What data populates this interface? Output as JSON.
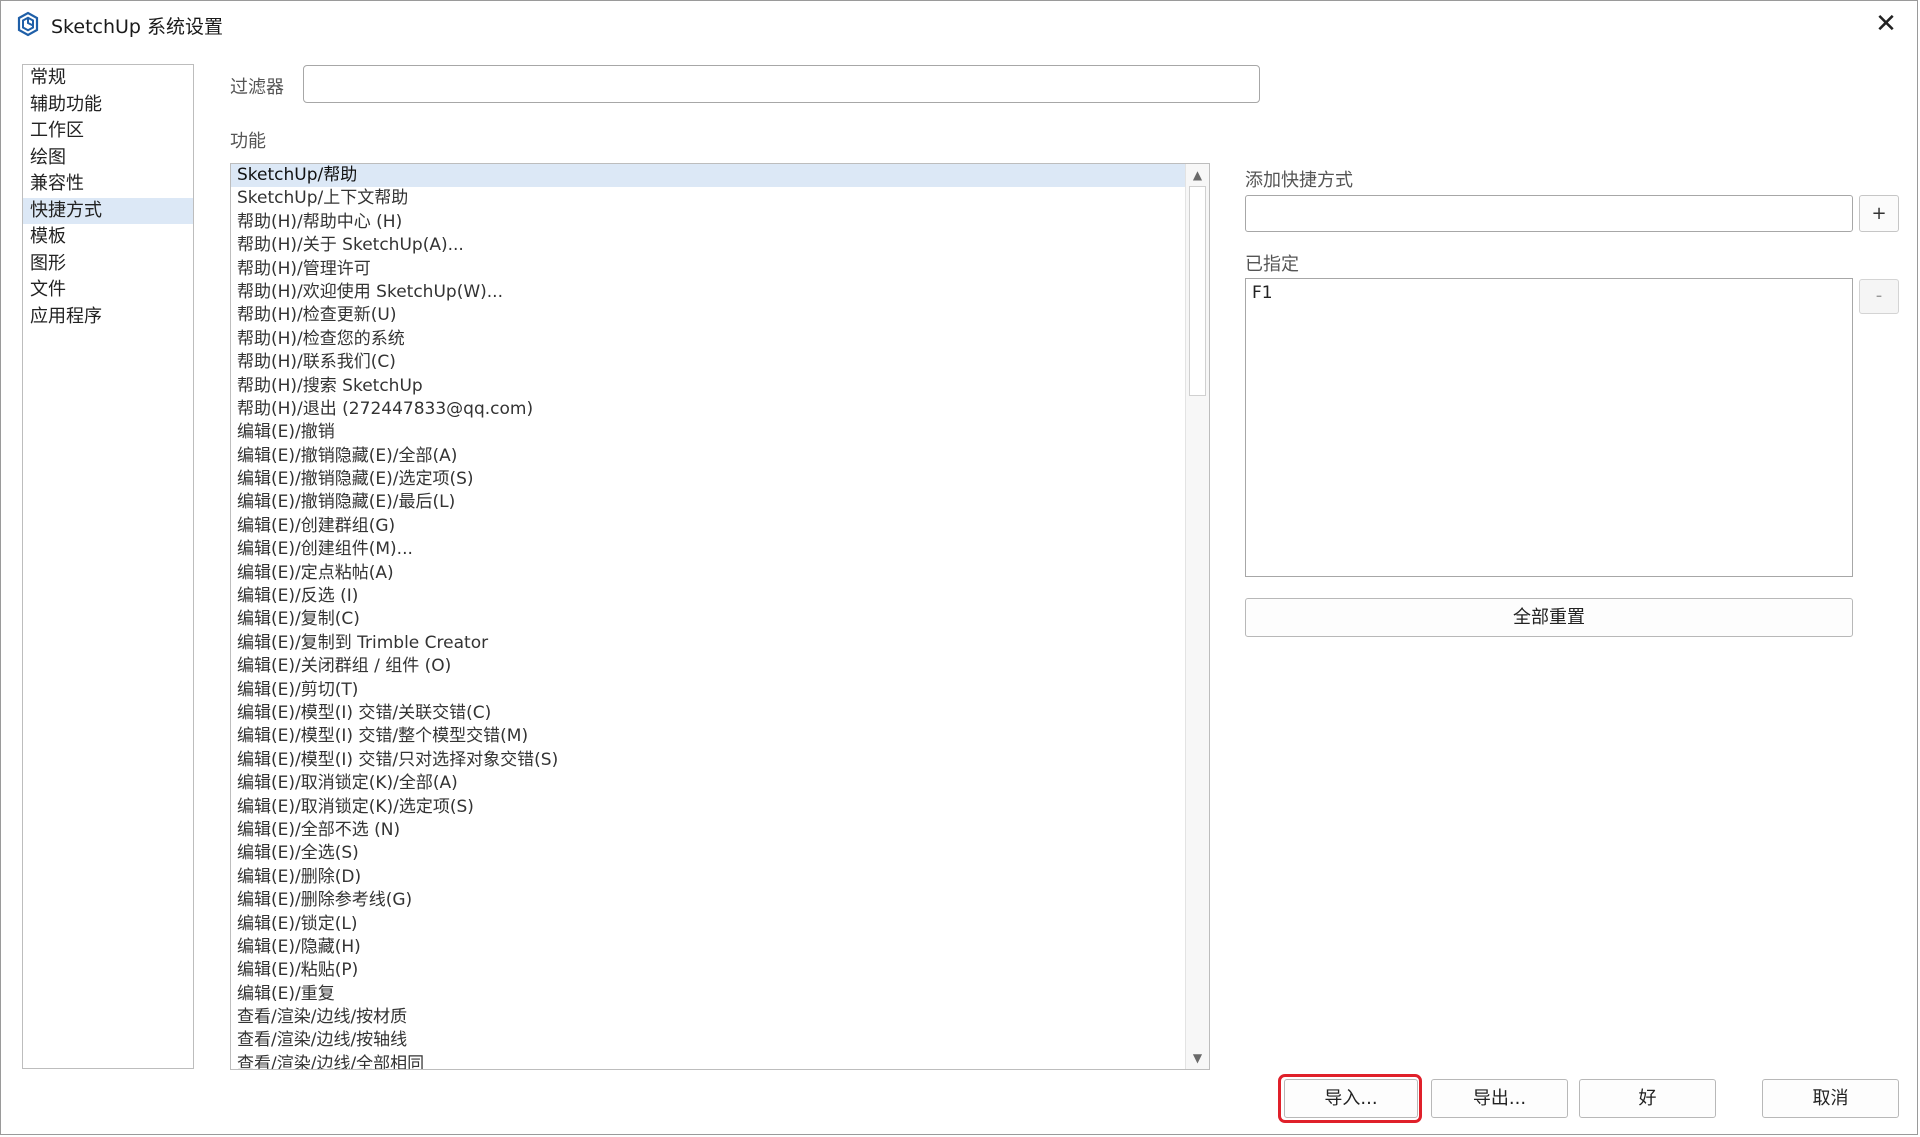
{
  "window": {
    "title": "SketchUp 系统设置",
    "close_label": "✕",
    "icon": "sketchup-logo-icon"
  },
  "nav": {
    "selected_index": 5,
    "items": [
      "常规",
      "辅助功能",
      "工作区",
      "绘图",
      "兼容性",
      "快捷方式",
      "模板",
      "图形",
      "文件",
      "应用程序"
    ]
  },
  "filter": {
    "label": "过滤器",
    "value": ""
  },
  "functions": {
    "label": "功能",
    "selected_index": 0,
    "items": [
      "SketchUp/帮助",
      "SketchUp/上下文帮助",
      "帮助(H)/帮助中心 (H)",
      "帮助(H)/关于 SketchUp(A)...",
      "帮助(H)/管理许可",
      "帮助(H)/欢迎使用 SketchUp(W)...",
      "帮助(H)/检查更新(U)",
      "帮助(H)/检查您的系统",
      "帮助(H)/联系我们(C)",
      "帮助(H)/搜索 SketchUp",
      "帮助(H)/退出 (272447833@qq.com)",
      "编辑(E)/撤销",
      "编辑(E)/撤销隐藏(E)/全部(A)",
      "编辑(E)/撤销隐藏(E)/选定项(S)",
      "编辑(E)/撤销隐藏(E)/最后(L)",
      "编辑(E)/创建群组(G)",
      "编辑(E)/创建组件(M)...",
      "编辑(E)/定点粘帖(A)",
      "编辑(E)/反选 (I)",
      "编辑(E)/复制(C)",
      "编辑(E)/复制到 Trimble Creator",
      "编辑(E)/关闭群组 / 组件 (O)",
      "编辑(E)/剪切(T)",
      "编辑(E)/模型(I) 交错/关联交错(C)",
      "编辑(E)/模型(I) 交错/整个模型交错(M)",
      "编辑(E)/模型(I) 交错/只对选择对象交错(S)",
      "编辑(E)/取消锁定(K)/全部(A)",
      "编辑(E)/取消锁定(K)/选定项(S)",
      "编辑(E)/全部不选 (N)",
      "编辑(E)/全选(S)",
      "编辑(E)/删除(D)",
      "编辑(E)/删除参考线(G)",
      "编辑(E)/锁定(L)",
      "编辑(E)/隐藏(H)",
      "编辑(E)/粘贴(P)",
      "编辑(E)/重复",
      "查看/渲染/边线/按材质",
      "查看/渲染/边线/按轴线",
      "查看/渲染/边线/全部相同"
    ]
  },
  "shortcuts": {
    "add_label": "添加快捷方式",
    "add_value": "",
    "plus_label": "+",
    "assigned_label": "已指定",
    "assigned_items": [
      "F1"
    ],
    "minus_label": "-",
    "reset_label": "全部重置"
  },
  "footer": {
    "import_label": "导入...",
    "export_label": "导出...",
    "ok_label": "好",
    "cancel_label": "取消",
    "highlight_color": "#e0202a"
  }
}
